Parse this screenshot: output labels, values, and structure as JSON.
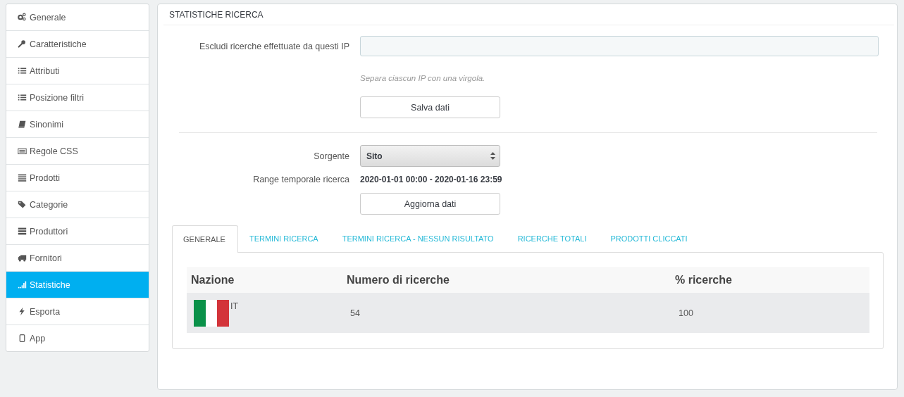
{
  "sidebar": {
    "items": [
      {
        "label": "Generale",
        "selected": false
      },
      {
        "label": "Caratteristiche",
        "selected": false
      },
      {
        "label": "Attributi",
        "selected": false
      },
      {
        "label": "Posizione filtri",
        "selected": false
      },
      {
        "label": "Sinonimi",
        "selected": false
      },
      {
        "label": "Regole CSS",
        "selected": false
      },
      {
        "label": "Prodotti",
        "selected": false
      },
      {
        "label": "Categorie",
        "selected": false
      },
      {
        "label": "Produttori",
        "selected": false
      },
      {
        "label": "Fornitori",
        "selected": false
      },
      {
        "label": "Statistiche",
        "selected": true
      },
      {
        "label": "Esporta",
        "selected": false
      },
      {
        "label": "App",
        "selected": false
      }
    ]
  },
  "panel": {
    "title": "STATISTICHE RICERCA",
    "exclude_ip": {
      "label": "Escludi ricerche effettuate da questi IP",
      "help": "Separa ciascun IP con una virgola."
    },
    "save_button": "Salva dati",
    "source": {
      "label": "Sorgente",
      "value": "Sito"
    },
    "range": {
      "label": "Range temporale ricerca",
      "value": "2020-01-01 00:00 - 2020-01-16 23:59"
    },
    "update_button": "Aggiorna dati",
    "tabs": [
      {
        "label": "GENERALE",
        "selected": true
      },
      {
        "label": "TERMINI RICERCA",
        "selected": false
      },
      {
        "label": "TERMINI RICERCA - NESSUN RISULTATO",
        "selected": false
      },
      {
        "label": "RICERCHE TOTALI",
        "selected": false
      },
      {
        "label": "PRODOTTI CLICCATI",
        "selected": false
      }
    ],
    "table": {
      "columns": [
        "Nazione",
        "Numero di ricerche",
        "% ricerche"
      ],
      "rows": [
        {
          "country": "IT",
          "searches": "54",
          "percent": "100"
        }
      ]
    }
  }
}
